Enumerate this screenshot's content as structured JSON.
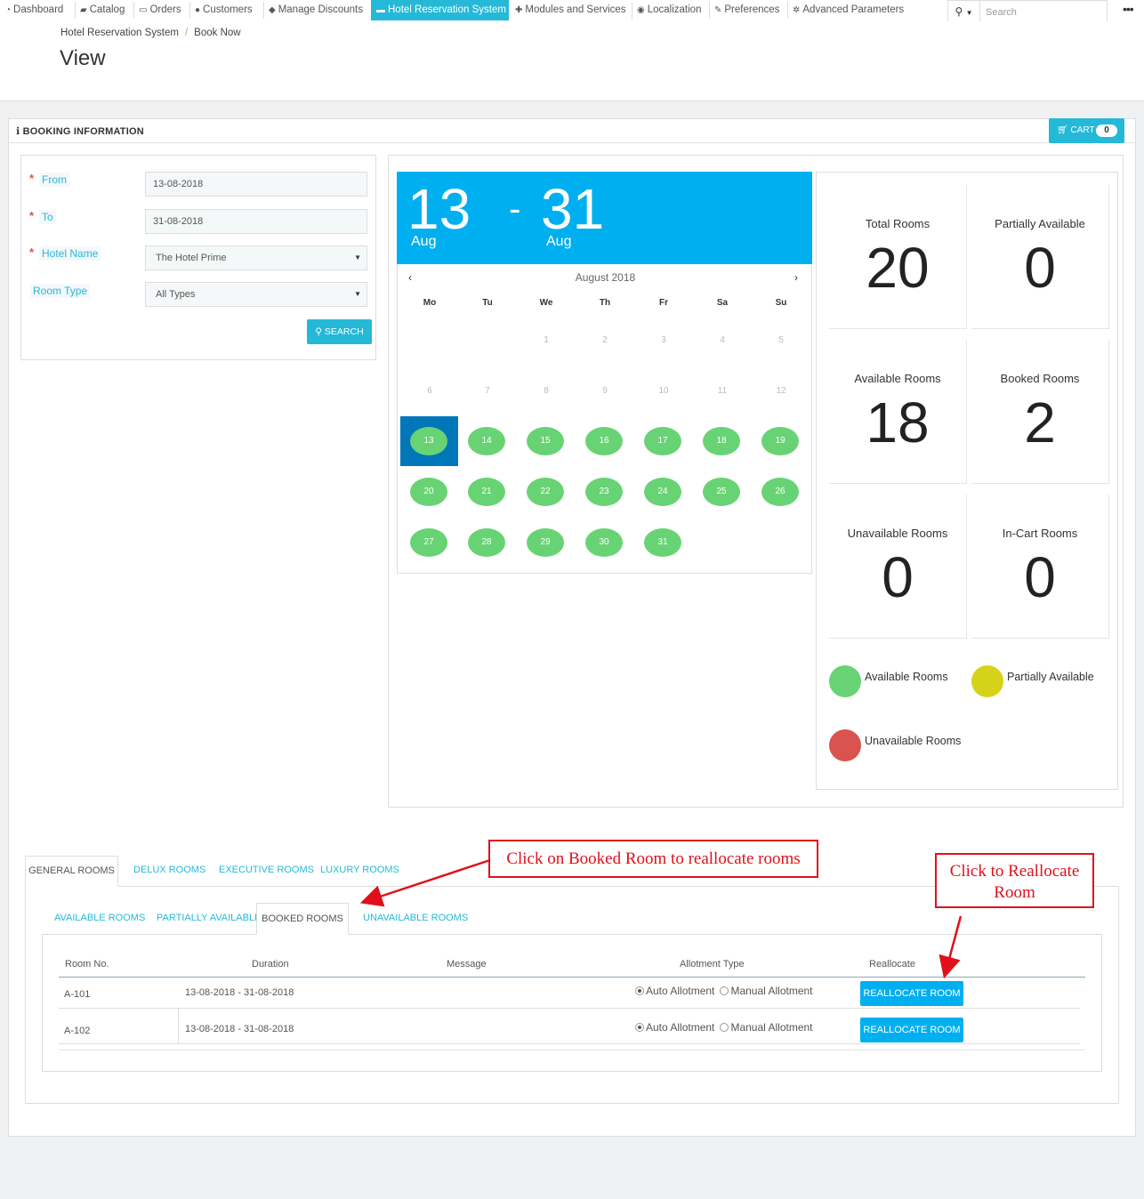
{
  "nav": {
    "items": [
      {
        "label": "Dashboard",
        "icon": "dashboard-icon"
      },
      {
        "label": "Catalog",
        "icon": "book-icon"
      },
      {
        "label": "Orders",
        "icon": "credit-card-icon"
      },
      {
        "label": "Customers",
        "icon": "users-icon"
      },
      {
        "label": "Manage Discounts",
        "icon": "tag-icon"
      },
      {
        "label": "Hotel Reservation System",
        "icon": "bed-icon"
      },
      {
        "label": "Modules and Services",
        "icon": "puzzle-icon"
      },
      {
        "label": "Localization",
        "icon": "globe-icon"
      },
      {
        "label": "Preferences",
        "icon": "wrench-icon"
      },
      {
        "label": "Advanced Parameters",
        "icon": "cogs-icon"
      }
    ],
    "active": "Hotel Reservation System",
    "search_placeholder": "Search",
    "accent": "#25b9d7"
  },
  "breadcrumb": {
    "parent": "Hotel Reservation System",
    "current": "Book Now"
  },
  "page_title": "View",
  "panel": {
    "title": "BOOKING INFORMATION",
    "cart_label": "CART",
    "cart_count": "0"
  },
  "form": {
    "from_label": "From",
    "from_value": "13-08-2018",
    "to_label": "To",
    "to_value": "31-08-2018",
    "hotel_label": "Hotel Name",
    "hotel_value": "The Hotel Prime",
    "room_type_label": "Room Type",
    "room_type_value": "All Types",
    "search_label": "SEARCH"
  },
  "calendar": {
    "from_day": "13",
    "from_month": "Aug",
    "dash": "-",
    "to_day": "31",
    "to_month": "Aug",
    "month_label": "August 2018",
    "prev": "‹",
    "next": "›",
    "weekdays": [
      "Mo",
      "Tu",
      "We",
      "Th",
      "Fr",
      "Sa",
      "Su"
    ],
    "inactive_days": [
      "1",
      "2",
      "3",
      "4",
      "5",
      "6",
      "7",
      "8",
      "9",
      "10",
      "11",
      "12"
    ],
    "available_days": [
      "13",
      "14",
      "15",
      "16",
      "17",
      "18",
      "19",
      "20",
      "21",
      "22",
      "23",
      "24",
      "25",
      "26",
      "27",
      "28",
      "29",
      "30",
      "31"
    ],
    "selected_day": "13",
    "available_color": "#68d374",
    "selected_color": "#0077b9"
  },
  "stats": {
    "total_label": "Total Rooms",
    "total_value": "20",
    "partial_label": "Partially Available",
    "partial_value": "0",
    "available_label": "Available Rooms",
    "available_value": "18",
    "booked_label": "Booked Rooms",
    "booked_value": "2",
    "unavailable_label": "Unavailable Rooms",
    "unavailable_value": "0",
    "incart_label": "In-Cart Rooms",
    "incart_value": "0"
  },
  "legend": {
    "available": "Available Rooms",
    "available_color": "#68d374",
    "partial": "Partially Available",
    "partial_color": "#d6d21a",
    "unavailable": "Unavailable Rooms",
    "unavailable_color": "#d9534f"
  },
  "room_tabs": [
    "GENERAL ROOMS",
    "DELUX ROOMS",
    "EXECUTIVE ROOMS",
    "LUXURY ROOMS"
  ],
  "status_tabs": [
    "AVAILABLE ROOMS",
    "PARTIALLY AVAILABLE",
    "BOOKED ROOMS",
    "UNAVAILABLE ROOMS"
  ],
  "table": {
    "headers": [
      "Room No.",
      "Duration",
      "Message",
      "Allotment Type",
      "Reallocate"
    ],
    "rows": [
      {
        "room": "A-101",
        "duration": "13-08-2018 - 31-08-2018",
        "auto": "Auto Allotment",
        "manual": "Manual Allotment",
        "button": "REALLOCATE ROOM"
      },
      {
        "room": "A-102",
        "duration": "13-08-2018 - 31-08-2018",
        "auto": "Auto Allotment",
        "manual": "Manual Allotment",
        "button": "REALLOCATE ROOM"
      }
    ]
  },
  "annotations": {
    "booked_hint": "Click on Booked Room to reallocate rooms",
    "realloc_hint_line1": "Click to Reallocate",
    "realloc_hint_line2": "Room"
  }
}
